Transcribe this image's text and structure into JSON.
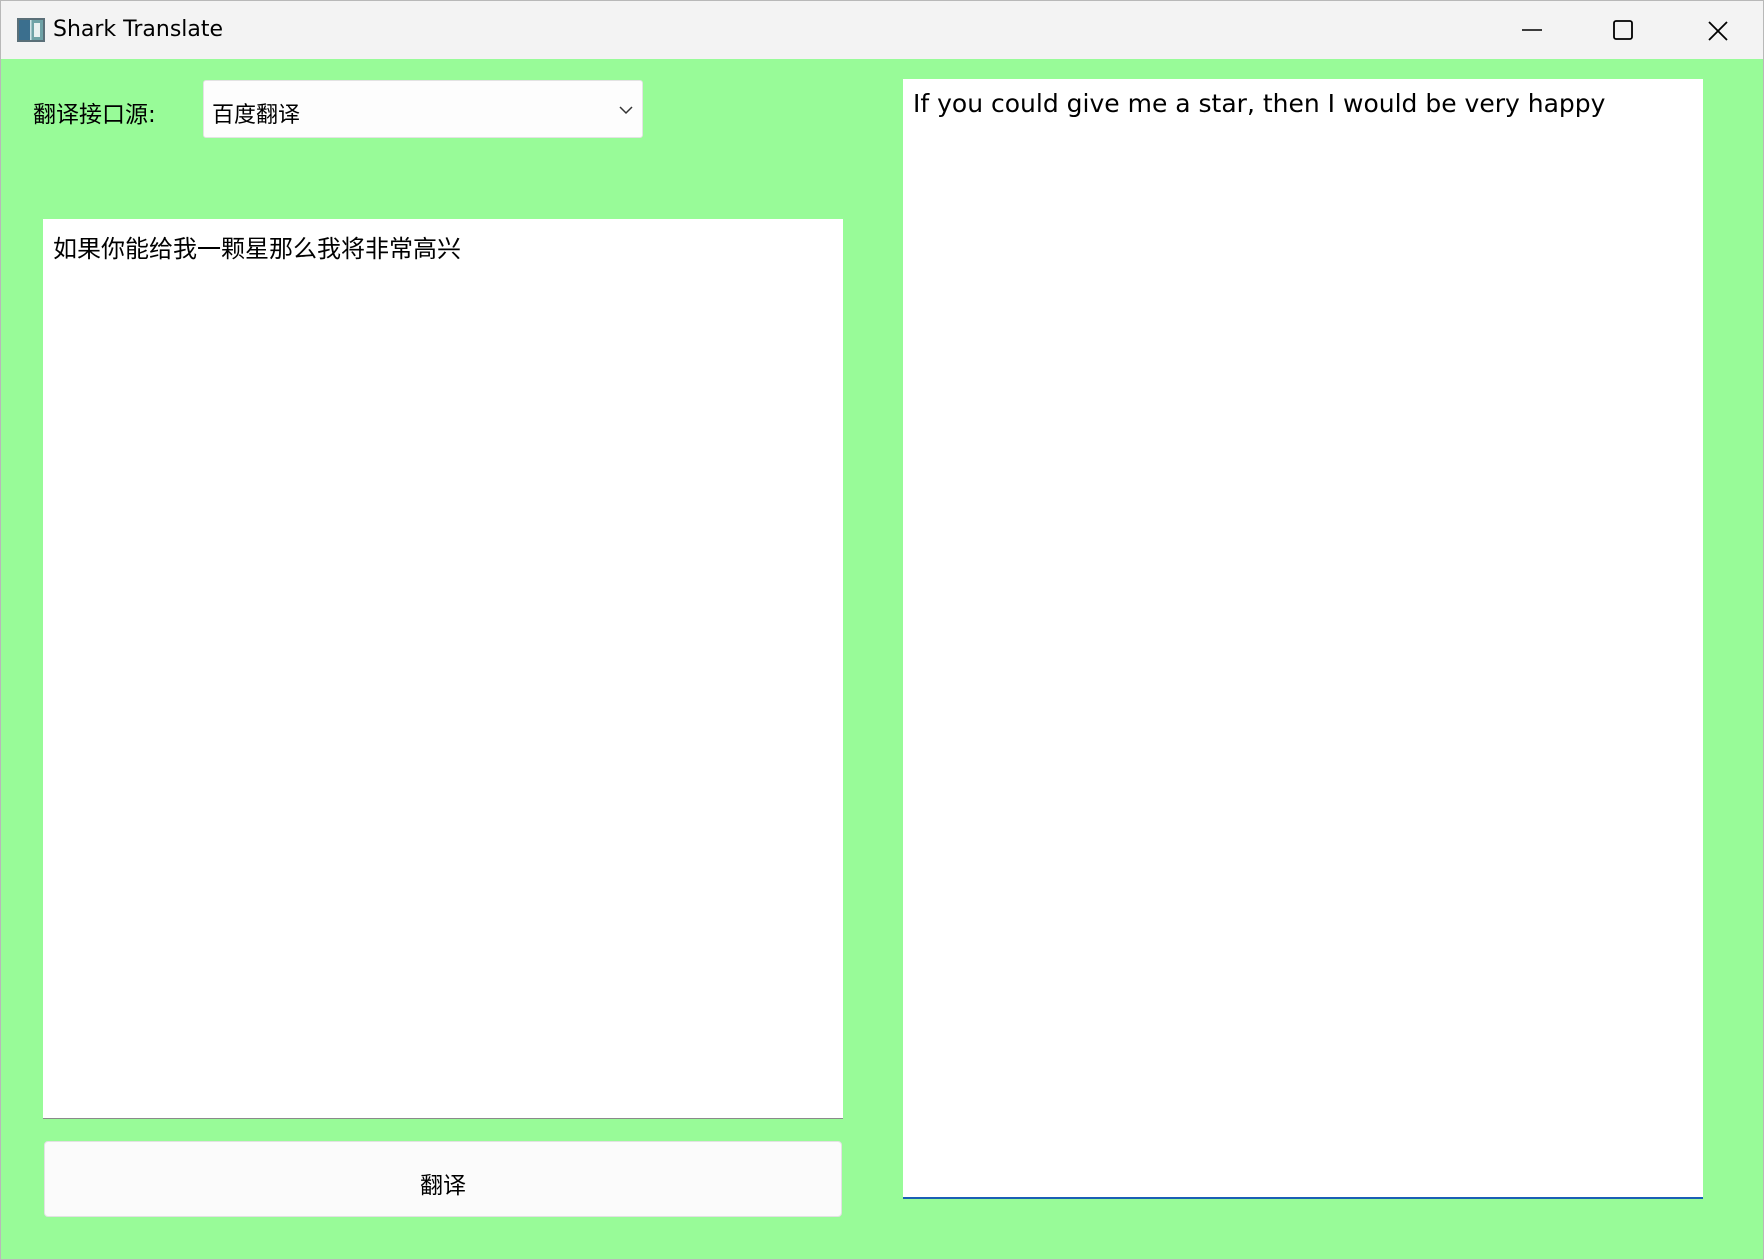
{
  "window": {
    "title": "Shark Translate",
    "icon": "app-window-icon",
    "controls": {
      "minimize_icon": "minimize-icon",
      "maximize_icon": "maximize-icon",
      "close_icon": "close-icon"
    }
  },
  "source": {
    "label": "翻译接口源:",
    "selected": "百度翻译",
    "arrow_icon": "chevron-down-icon"
  },
  "input": {
    "value": "如果你能给我一颗星那么我将非常高兴"
  },
  "translate_button": {
    "label": "翻译"
  },
  "output": {
    "value": "If you could give me a star, then I would be very happy"
  },
  "colors": {
    "background": "#98fb98",
    "titlebar": "#f3f3f3",
    "text_area": "#ffffff",
    "focus_underline": "#1a5fb4"
  }
}
